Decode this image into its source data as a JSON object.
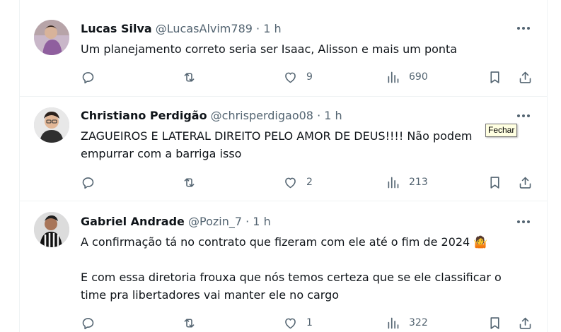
{
  "tweets": [
    {
      "name": "Lucas Silva",
      "handle": "@LucasAlvim789",
      "dot": "·",
      "time": "1 h",
      "text": "Um planejamento correto seria ser Isaac, Alisson e mais um ponta",
      "replies": "",
      "retweets": "",
      "likes": "9",
      "views": "690"
    },
    {
      "name": "Christiano Perdigão",
      "handle": "@chrisperdigao08",
      "dot": "·",
      "time": "1 h",
      "text": "ZAGUEIROS E LATERAL DIREITO PELO AMOR DE DEUS!!!! Não podem\nempurrar com a barriga isso",
      "replies": "",
      "retweets": "",
      "likes": "2",
      "views": "213"
    },
    {
      "name": "Gabriel Andrade",
      "handle": "@Pozin_7",
      "dot": "·",
      "time": "1 h",
      "text": "A confirmação tá no contrato que fizeram com ele até o fim de 2024 🤷\n\nE com essa diretoria frouxa que nós temos certeza que se ele classificar o\ntime pra libertadores vai manter ele no cargo",
      "replies": "",
      "retweets": "",
      "likes": "1",
      "views": "322"
    }
  ],
  "tooltip": {
    "text": "Fechar"
  },
  "icons": {
    "reply": "reply-icon",
    "retweet": "retweet-icon",
    "like": "heart-icon",
    "views": "views-icon",
    "bookmark": "bookmark-icon",
    "share": "share-icon",
    "more": "more-icon"
  },
  "colors": {
    "secondary_text": "#536471",
    "border": "#eff3f4",
    "text": "#0f1419"
  }
}
